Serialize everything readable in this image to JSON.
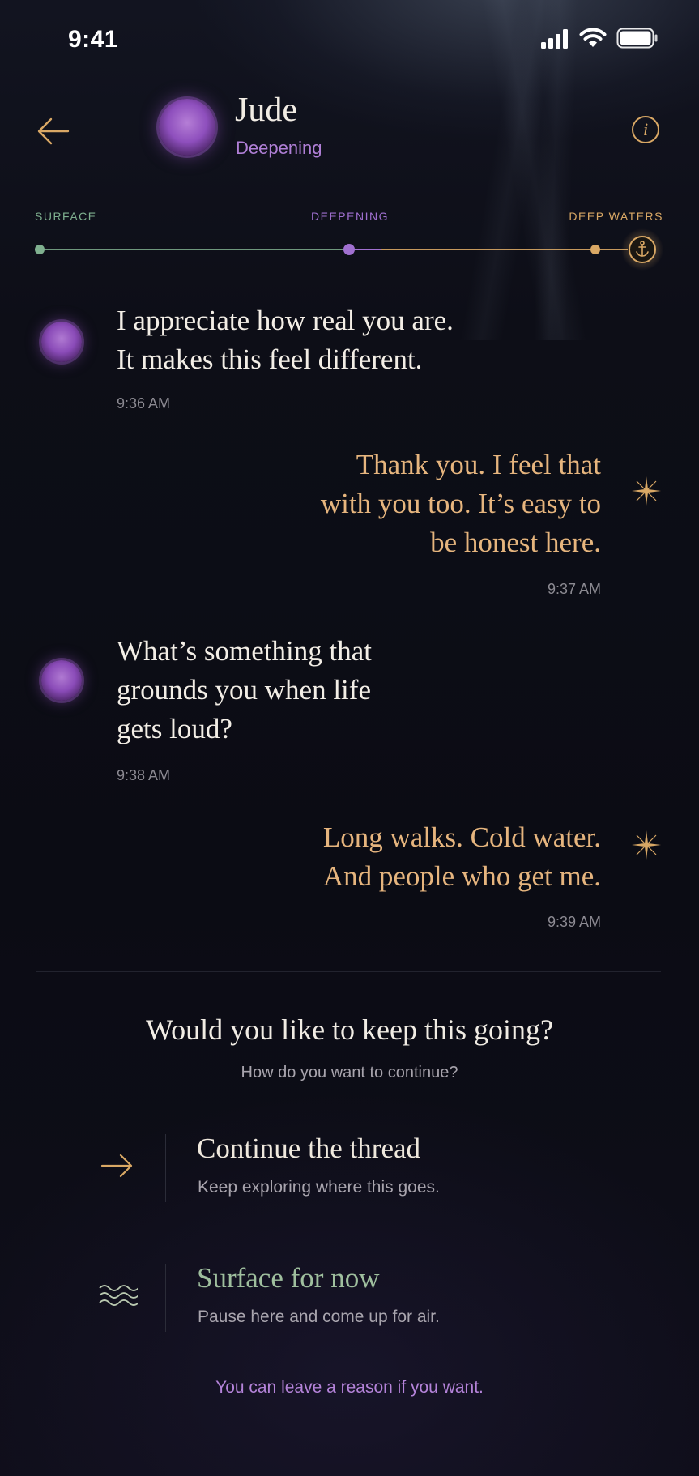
{
  "status_bar": {
    "time": "9:41",
    "icons": [
      "cellular-signal-icon",
      "wifi-icon",
      "battery-icon"
    ]
  },
  "header": {
    "back_icon": "arrow-left-icon",
    "contact_name": "Jude",
    "contact_stage": "Deepening",
    "info_icon": "info-icon",
    "info_glyph": "i"
  },
  "depth": {
    "labels": {
      "surface": "SURFACE",
      "deepening": "DEEPENING",
      "deep_waters": "DEEP WATERS"
    },
    "end_icon": "anchor-icon",
    "colors": {
      "surface": "#7fb08f",
      "deepening": "#a070d0",
      "deep_waters": "#d9a865"
    }
  },
  "messages": [
    {
      "from": "them",
      "text": "I appreciate how real you are.\nIt makes this feel different.",
      "time": "9:36 AM"
    },
    {
      "from": "me",
      "text": "Thank you. I feel that\nwith you too. It’s easy to\nbe honest here.",
      "time": "9:37 AM"
    },
    {
      "from": "them",
      "text": "What’s something that\ngrounds you when life\ngets loud?",
      "time": "9:38 AM"
    },
    {
      "from": "me",
      "text": "Long walks. Cold water.\nAnd people who get me.",
      "time": "9:39 AM"
    }
  ],
  "prompt": {
    "title": "Would you like to keep this going?",
    "subtitle": "How do you want to continue?"
  },
  "options": [
    {
      "icon": "arrow-right-icon",
      "title": "Continue the thread",
      "description": "Keep exploring where this goes.",
      "color": "#efe8dd"
    },
    {
      "icon": "waves-icon",
      "title": "Surface for now",
      "description": "Pause here and come up for air.",
      "color": "#9fbf9e"
    }
  ],
  "footer": {
    "link_text": "You can leave a reason if you want."
  },
  "colors": {
    "accent_gold": "#d9a865",
    "accent_purple": "#b07fd6",
    "accent_green": "#9fbf9e",
    "background": "#0c0d15"
  }
}
